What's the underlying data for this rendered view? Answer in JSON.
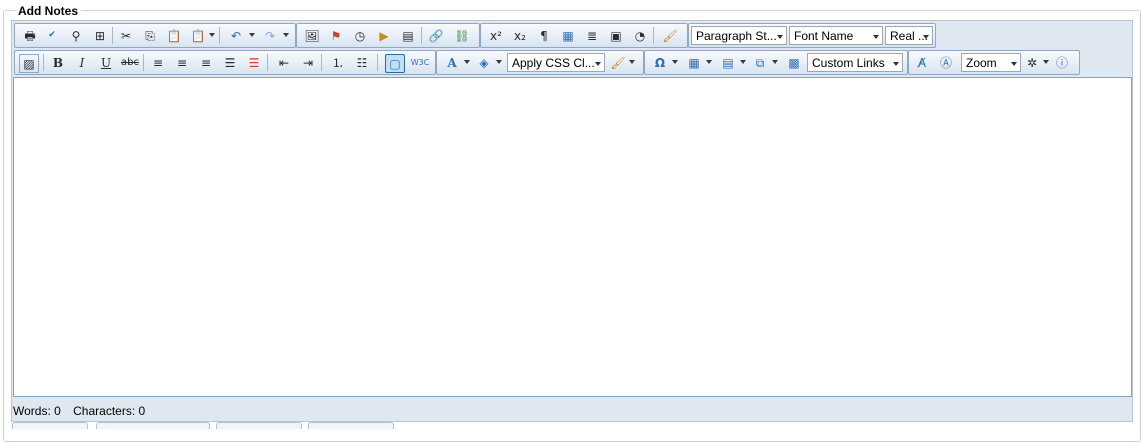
{
  "panel": {
    "title": "Add Notes"
  },
  "toolbar": {
    "paragraph_style": "Paragraph St...",
    "font_name": "Font Name",
    "font_size": "Real ...",
    "css_class": "Apply CSS Cl...",
    "custom_links": "Custom Links",
    "zoom": "Zoom"
  },
  "status": {
    "words_label": "Words: 0",
    "characters_label": "Characters: 0"
  },
  "colors": {
    "toolbar_border": "#8fa9c3",
    "editor_background": "#dfe8f1",
    "icon_blue": "#3c5d85"
  }
}
